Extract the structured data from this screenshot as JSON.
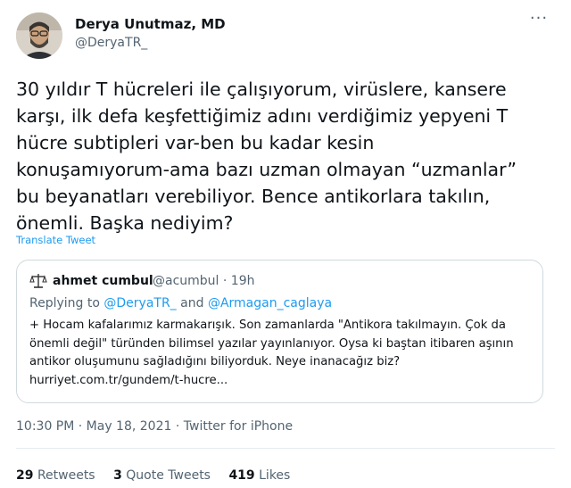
{
  "author": {
    "name": "Derya Unutmaz, MD",
    "handle": "@DeryaTR_"
  },
  "more_label": "···",
  "tweet_text": "30 yıldır T hücreleri ile çalışıyorum, virüslere, kansere\nkarşı, ilk defa keşfettiğimiz adını verdiğimiz yepyeni T\nhücre subtipleri var-ben bu kadar kesin\nkonuşamıyorum-ama bazı uzman olmayan “uzmanlar”\nbu beyanatları verebiliyor. Bence antikorlara takılın,\nönemli. Başka nediyim?",
  "translate_label": "Translate Tweet",
  "quoted": {
    "name": "ahmet cumbul",
    "handle_time": "@acumbul · 19h",
    "replying_prefix": "Replying to",
    "replying_user1": "@DeryaTR_",
    "replying_and": "and",
    "replying_user2": "@Armagan_caglaya",
    "text": "+ Hocam kafalarımız karmakarışık. Son zamanlarda \"Antikora takılmayın. Çok da\nönemli değil\" türünden bilimsel yazılar yayınlanıyor. Oysa ki baştan itibaren aşının\nantikor oluşumunu sağladığını biliyorduk. Neye inanacağız biz?\nhurriyet.com.tr/gundem/t-hucre..."
  },
  "meta": "10:30 PM · May 18, 2021 · Twitter for iPhone",
  "stats": {
    "retweets_count": "29",
    "retweets_label": "Retweets",
    "quotes_count": "3",
    "quotes_label": "Quote Tweets",
    "likes_count": "419",
    "likes_label": "Likes"
  },
  "colors": {
    "link": "#1d9bf0",
    "secondary_text": "#536471",
    "border": "#cfd9de"
  }
}
